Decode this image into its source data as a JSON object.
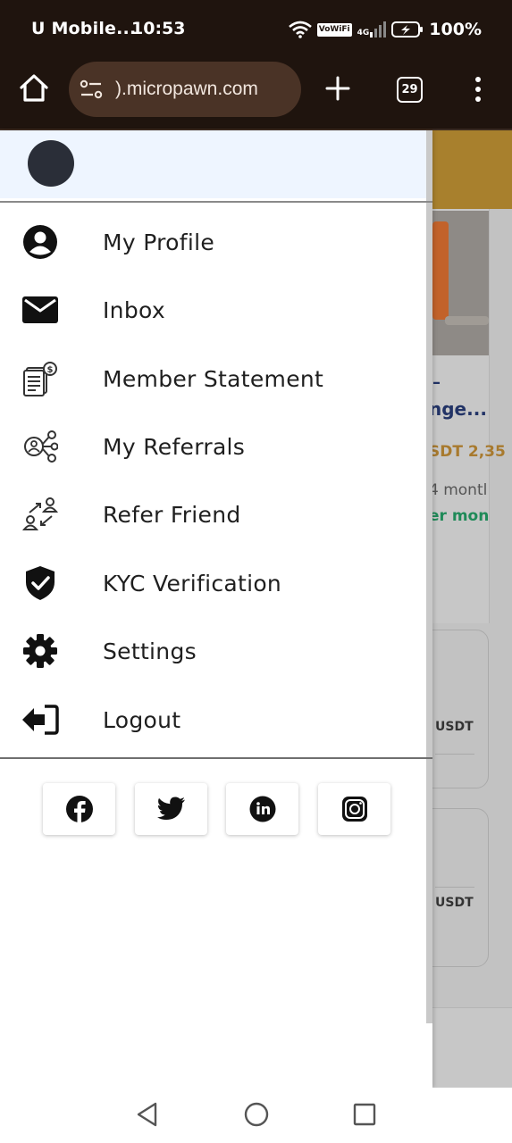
{
  "status_bar": {
    "carrier": "U Mobile...",
    "time": "10:53",
    "vowifi": "VoWiFi",
    "network": "4G",
    "battery": "100%"
  },
  "browser": {
    "url": ").micropawn.com",
    "tab_count": "29"
  },
  "drawer": {
    "menu": [
      {
        "label": "My Profile",
        "icon": "profile-icon"
      },
      {
        "label": "Inbox",
        "icon": "mail-icon"
      },
      {
        "label": "Member Statement",
        "icon": "statement-icon"
      },
      {
        "label": "My Referrals",
        "icon": "referrals-icon"
      },
      {
        "label": "Refer Friend",
        "icon": "refer-friend-icon"
      },
      {
        "label": "KYC Verification",
        "icon": "shield-check-icon"
      },
      {
        "label": "Settings",
        "icon": "gear-icon"
      },
      {
        "label": "Logout",
        "icon": "logout-icon"
      }
    ],
    "social": [
      "facebook-icon",
      "twitter-icon",
      "linkedin-icon",
      "instagram-icon"
    ]
  },
  "background_page": {
    "title_line1": "–",
    "title_line2": "nge...",
    "price": "SDT 2,35",
    "months": "4 montl",
    "months_green": "er mon",
    "currency_1": "USDT",
    "currency_2": "USDT"
  },
  "colors": {
    "browser_bar": "#1f140e",
    "url_pill": "#4a3326",
    "drawer_header": "#eef5ff",
    "banner": "#a8802d"
  }
}
